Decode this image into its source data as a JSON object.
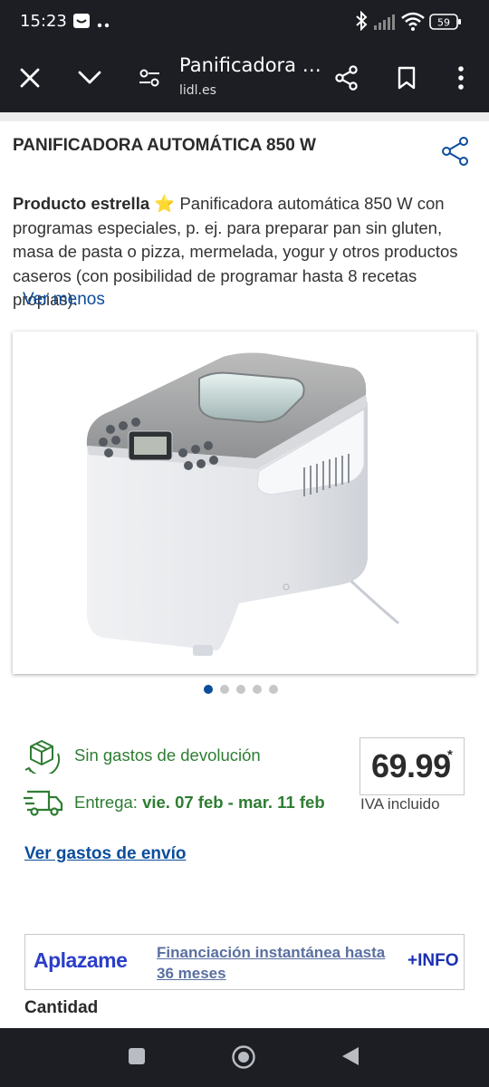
{
  "status_bar": {
    "time": "15:23",
    "battery": "59"
  },
  "toolbar": {
    "title": "Panificadora …",
    "url": "lidl.es"
  },
  "product": {
    "title": "PANIFICADORA AUTOMÁTICA 850 W",
    "badge": "Producto estrella",
    "badge_emoji": "⭐",
    "description": " Panificadora automática 850 W con programas especiales, p. ej. para preparar pan sin gluten, masa de pasta o pizza, mermelada, yogur y otros productos caseros (con posibilidad de programar hasta 8 recetas propias).",
    "toggle_label": "Ver menos",
    "image_count": 5,
    "active_image": 1
  },
  "shipping": {
    "returns_label": "Sin gastos de devolución",
    "delivery_prefix": "Entrega: ",
    "delivery_dates": "vie. 07 feb - mar. 11 feb",
    "shipping_link": "Ver gastos de envío"
  },
  "price": {
    "value": "69.99",
    "marker": "*",
    "tax_note": "IVA incluido"
  },
  "financing": {
    "brand": "Aplazame",
    "text": "Financiación instantánea hasta 36 meses",
    "info": "+INFO"
  },
  "quantity_label": "Cantidad",
  "colors": {
    "toolbar_bg": "#1c1e24",
    "link_blue": "#0b4d9b",
    "green": "#2e7d32",
    "aplazame_blue": "#2b3ec9"
  }
}
